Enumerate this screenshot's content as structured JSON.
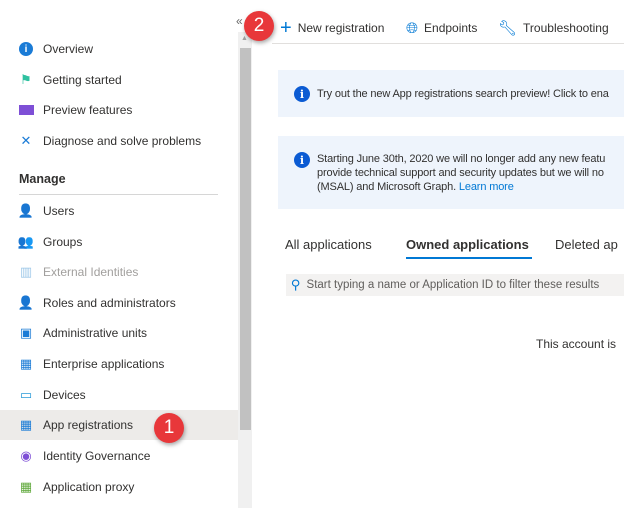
{
  "sidebar": {
    "items": [
      {
        "label": "Overview",
        "icon": "info-icon"
      },
      {
        "label": "Getting started",
        "icon": "flag-icon"
      },
      {
        "label": "Preview features",
        "icon": "preview-icon"
      },
      {
        "label": "Diagnose and solve problems",
        "icon": "wrench-icon"
      }
    ],
    "section_title": "Manage",
    "manage_items": [
      {
        "label": "Users"
      },
      {
        "label": "Groups"
      },
      {
        "label": "External Identities"
      },
      {
        "label": "Roles and administrators"
      },
      {
        "label": "Administrative units"
      },
      {
        "label": "Enterprise applications"
      },
      {
        "label": "Devices"
      },
      {
        "label": "App registrations"
      },
      {
        "label": "Identity Governance"
      },
      {
        "label": "Application proxy"
      }
    ]
  },
  "callouts": {
    "one": "1",
    "two": "2"
  },
  "toolbar": {
    "new_registration": "New registration",
    "endpoints": "Endpoints",
    "troubleshooting": "Troubleshooting"
  },
  "banners": {
    "search_preview": "Try out the new App registrations search preview! Click to ena",
    "deprecation_line1": "Starting June 30th, 2020 we will no longer add any new featu",
    "deprecation_line2": "provide technical support and security updates but we will no",
    "deprecation_line3": "(MSAL) and Microsoft Graph.",
    "learn_more": "Learn more"
  },
  "tabs": {
    "all": "All applications",
    "owned": "Owned applications",
    "deleted": "Deleted ap"
  },
  "search": {
    "placeholder": "Start typing a name or Application ID to filter these results"
  },
  "empty_message": "This account is",
  "colors": {
    "accent": "#0078d4",
    "callout": "#e8373a",
    "selected": "#edebe9"
  }
}
